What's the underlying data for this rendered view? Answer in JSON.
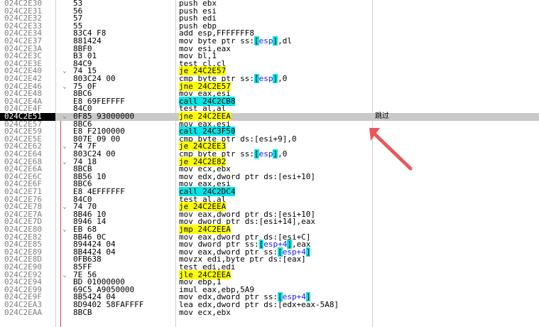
{
  "rows": [
    {
      "addr": "024C2E30",
      "bytes": "53",
      "op": "push ebx"
    },
    {
      "addr": "024C2E31",
      "bytes": "56",
      "op": "push esi"
    },
    {
      "addr": "024C2E32",
      "bytes": "57",
      "op": "push edi"
    },
    {
      "addr": "024C2E33",
      "bytes": "55",
      "op": "push ebp"
    },
    {
      "addr": "024C2E34",
      "bytes": "83C4 F8",
      "op": "add esp,FFFFFFF8"
    },
    {
      "addr": "024C2E37",
      "bytes": "881424",
      "op": "mov byte ptr ss:[esp],dl"
    },
    {
      "addr": "024C2E3A",
      "bytes": "8BF0",
      "op": "mov esi,eax"
    },
    {
      "addr": "024C2E3C",
      "bytes": "B3 01",
      "op": "mov bl,1"
    },
    {
      "addr": "024C2E3E",
      "bytes": "84C9",
      "op": "test cl,cl"
    },
    {
      "addr": "024C2E40",
      "bytes": "74 15",
      "op": "je 24C2E57",
      "mark": "v"
    },
    {
      "addr": "024C2E42",
      "bytes": "803C24 00",
      "op": "cmp byte ptr ss:[esp],0"
    },
    {
      "addr": "024C2E46",
      "bytes": "75 0F",
      "op": "jne 24C2E57",
      "mark": "v"
    },
    {
      "addr": "024C2E48",
      "bytes": "8BC6",
      "op": "mov eax,esi"
    },
    {
      "addr": "024C2E4A",
      "bytes": "E8 69FEFFFF",
      "op": "call 24C2CB8"
    },
    {
      "addr": "024C2E4F",
      "bytes": "84C0",
      "op": "test al,al"
    },
    {
      "addr": "024C2E51",
      "bytes": "0F85 93000000",
      "op": "jne 24C2EEA",
      "mark": "v",
      "comment": "跳过"
    },
    {
      "addr": "024C2E57",
      "bytes": "8BC6",
      "op": "mov eax,esi"
    },
    {
      "addr": "024C2E59",
      "bytes": "E8 F2100000",
      "op": "call 24C3F50"
    },
    {
      "addr": "024C2E5E",
      "bytes": "807E 09 00",
      "op": "cmp byte ptr ds:[esi+9],0"
    },
    {
      "addr": "024C2E62",
      "bytes": "74 7F",
      "op": "je 24C2EE3",
      "mark": "v"
    },
    {
      "addr": "024C2E64",
      "bytes": "803C24 00",
      "op": "cmp byte ptr ss:[esp],0"
    },
    {
      "addr": "024C2E68",
      "bytes": "74 18",
      "op": "je 24C2E82",
      "mark": "v"
    },
    {
      "addr": "024C2E6A",
      "bytes": "8BCB",
      "op": "mov ecx,ebx"
    },
    {
      "addr": "024C2E6C",
      "bytes": "8B56 10",
      "op": "mov edx,dword ptr ds:[esi+10]"
    },
    {
      "addr": "024C2E6F",
      "bytes": "8BC6",
      "op": "mov eax,esi"
    },
    {
      "addr": "024C2E71",
      "bytes": "E8 4EFFFFFF",
      "op": "call 24C2DC4"
    },
    {
      "addr": "024C2E76",
      "bytes": "84C0",
      "op": "test al,al"
    },
    {
      "addr": "024C2E78",
      "bytes": "74 70",
      "op": "je 24C2EEA",
      "mark": "v"
    },
    {
      "addr": "024C2E7A",
      "bytes": "8B46 10",
      "op": "mov eax,dword ptr ds:[esi+10]"
    },
    {
      "addr": "024C2E7D",
      "bytes": "8946 14",
      "op": "mov dword ptr ds:[esi+14],eax"
    },
    {
      "addr": "024C2E80",
      "bytes": "EB 68",
      "op": "jmp 24C2EEA",
      "mark": "v"
    },
    {
      "addr": "024C2E82",
      "bytes": "8B46 0C",
      "op": "mov eax,dword ptr ds:[esi+C]"
    },
    {
      "addr": "024C2E85",
      "bytes": "894424 04",
      "op": "mov dword ptr ss:[esp+4],eax"
    },
    {
      "addr": "024C2E89",
      "bytes": "8B4424 04",
      "op": "mov eax,dword ptr ss:[esp+4]"
    },
    {
      "addr": "024C2E8D",
      "bytes": "0FB638",
      "op": "movzx edi,byte ptr ds:[eax]"
    },
    {
      "addr": "024C2E90",
      "bytes": "85FF",
      "op": "test edi,edi"
    },
    {
      "addr": "024C2E92",
      "bytes": "7E 56",
      "op": "jle 24C2EEA",
      "mark": "v"
    },
    {
      "addr": "024C2E94",
      "bytes": "BD 01000000",
      "op": "mov ebp,1"
    },
    {
      "addr": "024C2E99",
      "bytes": "69C5 A9050000",
      "op": "imul eax,ebp,5A9"
    },
    {
      "addr": "024C2E9F",
      "bytes": "8B5424 04",
      "op": "mov edx,dword ptr ss:[esp+4]"
    },
    {
      "addr": "024C2EA3",
      "bytes": "8D9402 58FAFFFF",
      "op": "lea edx,dword ptr ds:[edx+eax-5A8]"
    },
    {
      "addr": "024C2EAA",
      "bytes": "8BCB",
      "op": "mov ecx,ebx"
    }
  ],
  "selected_addr": "024C2E51",
  "colors": {
    "selection": "#c9c9c9",
    "jump_highlight": "#ffff00",
    "call_highlight": "#00e5e5",
    "arrow": "#e8585a"
  }
}
